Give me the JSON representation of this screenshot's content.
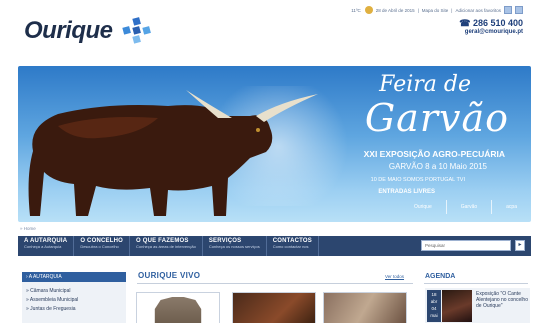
{
  "header": {
    "logo_text": "Ourique",
    "topbar": [
      "11ºC",
      "28 de Abril de 2015",
      "Mapa do Site",
      "Adicionar aos favoritos"
    ],
    "phone": "☎ 286 510 400",
    "email": "geral@cmourique.pt"
  },
  "banner": {
    "title_line1": "Feira de",
    "title_line2": "Garvão",
    "subtitle": "XXI EXPOSIÇÃO AGRO-PECUÁRIA",
    "dates": "GARVÃO 8 a 10 Maio 2015",
    "tv": "10 DE MAIO SOMOS PORTUGAL TVI",
    "free": "ENTRADAS LIVRES",
    "logos": [
      "Ourique",
      "Garvão",
      "acpa"
    ]
  },
  "breadcrumb": "» Home",
  "nav": [
    {
      "title": "A AUTARQUIA",
      "sub": "Conheça a Autarquia"
    },
    {
      "title": "O CONCELHO",
      "sub": "Descubra o Concelho"
    },
    {
      "title": "O QUE FAZEMOS",
      "sub": "Conheça as áreas de intervenção"
    },
    {
      "title": "SERVIÇOS",
      "sub": "Conheça os nossos serviços"
    },
    {
      "title": "CONTACTOS",
      "sub": "Como contactar nos"
    }
  ],
  "search": {
    "placeholder": "Pesquisar",
    "button": "▸"
  },
  "sidebar": {
    "heading": "› A AUTARQUIA",
    "items": [
      "» Câmara Municipal",
      "» Assembleia Municipal",
      "» Juntas de Freguesia"
    ]
  },
  "ourique_vivo": {
    "title": "OURIQUE VIVO",
    "link": "Ver todos"
  },
  "agenda": {
    "title": "AGENDA",
    "day": "18",
    "month1": "abr",
    "day2": "04",
    "month2": "mai",
    "text": "Exposição \"O Cante Alentejano no concelho de Ourique\""
  },
  "colors": {
    "nav": "#2c466f",
    "accent": "#2f5f9f"
  }
}
